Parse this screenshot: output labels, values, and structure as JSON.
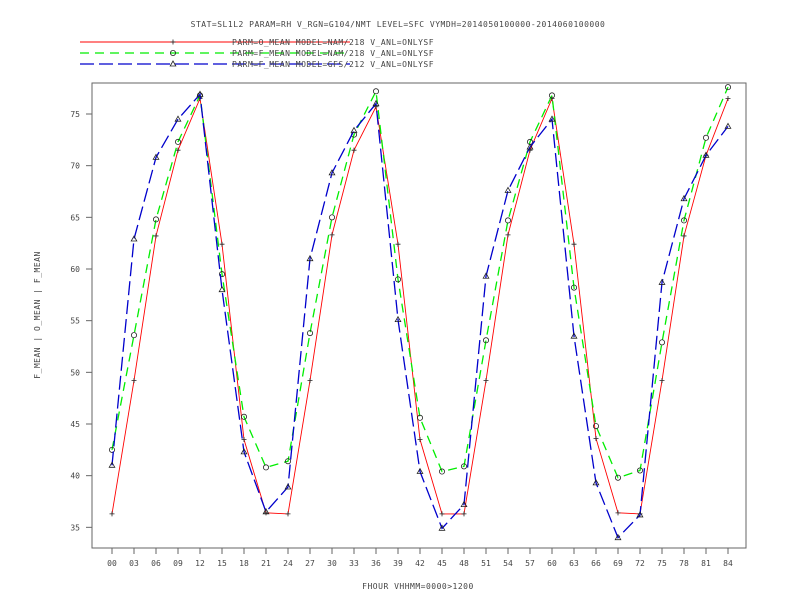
{
  "chart_data": {
    "type": "line",
    "title": "STAT=SL1L2 PARAM=RH V_RGN=G104/NMT LEVEL=SFC VYMDH=2014050100000-2014060100000",
    "xlabel": "FHOUR VHHMM=0000>1200",
    "ylabel": "F_MEAN | O_MEAN | F_MEAN",
    "categories": [
      "00",
      "03",
      "06",
      "09",
      "12",
      "15",
      "18",
      "21",
      "24",
      "27",
      "30",
      "33",
      "36",
      "39",
      "42",
      "45",
      "48",
      "51",
      "54",
      "57",
      "60",
      "63",
      "66",
      "69",
      "72",
      "75",
      "78",
      "81",
      "84"
    ],
    "ylim": [
      33,
      78
    ],
    "yticks": [
      35,
      40,
      45,
      50,
      55,
      60,
      65,
      70,
      75
    ],
    "grid": false,
    "legend_position": "top-left",
    "series": [
      {
        "name": "PARM=O_MEAN MODEL=NAM/218 V_ANL=ONLYSF",
        "color": "#ff0000",
        "dash": "",
        "marker": "plus",
        "values": [
          36.3,
          49.2,
          63.2,
          71.5,
          76.5,
          62.4,
          43.5,
          36.4,
          36.3,
          49.2,
          63.3,
          71.5,
          75.7,
          62.4,
          43.5,
          36.3,
          36.3,
          49.2,
          63.3,
          71.5,
          76.5,
          62.4,
          43.6,
          36.4,
          36.3,
          49.2,
          63.2,
          71.0,
          76.5
        ]
      },
      {
        "name": "PARM=F_MEAN MODEL=NAM/218 V_ANL=ONLYSF",
        "color": "#00ee00",
        "dash": "9,6",
        "marker": "circle",
        "values": [
          42.5,
          53.6,
          64.8,
          72.3,
          76.8,
          59.5,
          45.7,
          40.8,
          41.4,
          53.8,
          65.0,
          73.0,
          77.2,
          59.0,
          45.6,
          40.4,
          40.9,
          53.1,
          64.7,
          72.3,
          76.8,
          58.2,
          44.8,
          39.8,
          40.5,
          52.9,
          64.7,
          72.7,
          77.6
        ]
      },
      {
        "name": "PARM=F_MEAN MODEL=GFS/212 V_ANL=ONLYSF",
        "color": "#0000cc",
        "dash": "14,5",
        "marker": "triangle",
        "values": [
          41.0,
          62.9,
          70.8,
          74.5,
          76.9,
          58.0,
          42.3,
          36.5,
          38.9,
          61.0,
          69.3,
          73.4,
          76.0,
          55.1,
          40.4,
          34.9,
          37.2,
          59.3,
          67.6,
          71.8,
          74.5,
          53.5,
          39.3,
          34.0,
          36.2,
          58.7,
          66.8,
          71.0,
          73.8
        ]
      }
    ]
  }
}
